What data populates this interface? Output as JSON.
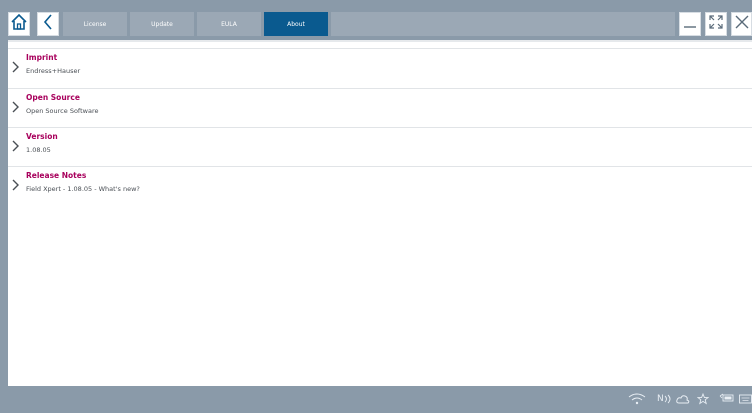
{
  "toolbar": {
    "tabs": [
      {
        "label": "License"
      },
      {
        "label": "Update"
      },
      {
        "label": "EULA"
      },
      {
        "label": "About"
      }
    ]
  },
  "about": {
    "items": [
      {
        "title": "Imprint",
        "subtitle": "Endress+Hauser"
      },
      {
        "title": "Open Source",
        "subtitle": "Open Source Software"
      },
      {
        "title": "Version",
        "subtitle": "1.08.05"
      },
      {
        "title": "Release Notes",
        "subtitle": "Field Xpert - 1.08.05 - What's new?"
      }
    ]
  },
  "status_bar": {
    "nfc_label": "N"
  },
  "colors": {
    "frame": "#8a9aa9",
    "active_tab": "#0a5a8f",
    "item_title": "#a8005c"
  },
  "icons": [
    "home-icon",
    "back-icon",
    "minimize-icon",
    "fullscreen-icon",
    "close-icon",
    "chevron-right-icon",
    "wifi-icon",
    "nfc-icon",
    "cloud-icon",
    "star-icon",
    "battery-icon",
    "keyboard-icon"
  ]
}
